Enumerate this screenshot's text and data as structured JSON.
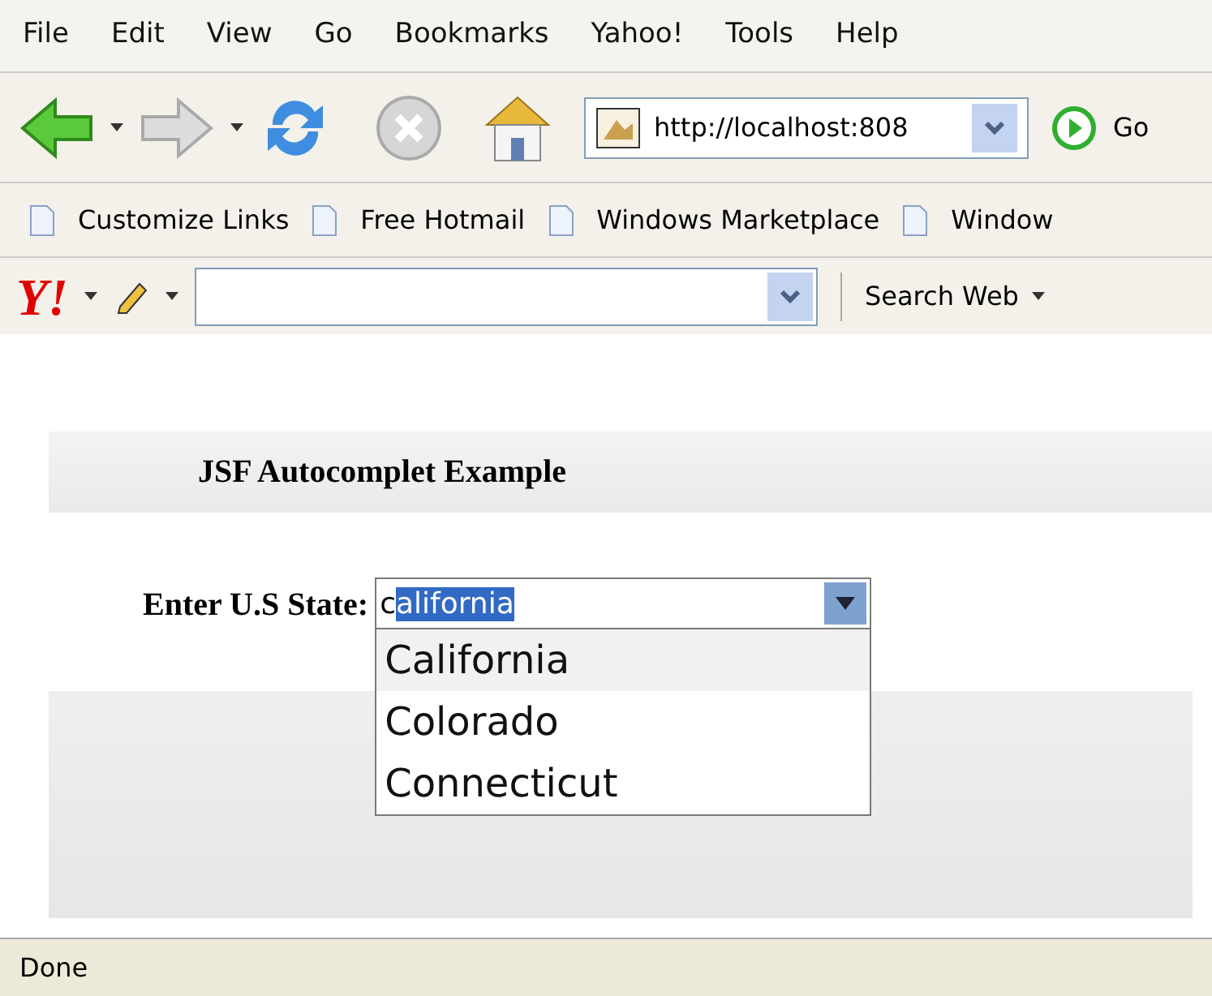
{
  "menu": [
    "File",
    "Edit",
    "View",
    "Go",
    "Bookmarks",
    "Yahoo!",
    "Tools",
    "Help"
  ],
  "address": {
    "url": "http://localhost:808",
    "go": "Go"
  },
  "bookmarks": [
    "Customize Links",
    "Free Hotmail",
    "Windows Marketplace",
    "Window"
  ],
  "yahoo_bar": {
    "logo": "Y!",
    "search_button": "Search Web"
  },
  "page": {
    "heading": "JSF Autocomplet Example",
    "label": "Enter U.S State:",
    "input": {
      "typed": "c",
      "suggested": "alifornia"
    },
    "suggestions": [
      {
        "label": "California",
        "selected": true
      },
      {
        "label": "Colorado",
        "selected": false
      },
      {
        "label": "Connecticut",
        "selected": false
      }
    ]
  },
  "status_bar": "Done"
}
